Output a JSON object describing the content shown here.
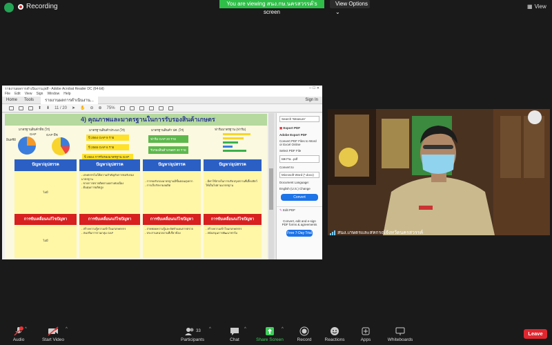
{
  "zoom": {
    "recording_label": "Recording",
    "share_banner": "You are viewing สนง.กษ.นครสวรรค์'s screen",
    "view_options_label": "View Options",
    "view_label": "View",
    "participant_name": "สนง.เกษตรและสหกรณ์จังหวัดนครสวรรค์",
    "participant_count": "33",
    "leave_label": "Leave",
    "controls": {
      "audio": "Audio",
      "start_video": "Start Video",
      "participants": "Participants",
      "chat": "Chat",
      "share_screen": "Share Screen",
      "record": "Record",
      "reactions": "Reactions",
      "apps": "Apps",
      "whiteboards": "Whiteboards"
    },
    "colors": {
      "banner": "#2fbe48",
      "leave": "#e0272f",
      "share_accent": "#3fce5c"
    }
  },
  "acrobat": {
    "window_title": "รายงานผลการดำเนินงาน.pdf - Adobe Acrobat Reader DC (64-bit)",
    "menu": [
      "File",
      "Edit",
      "View",
      "Sign",
      "Window",
      "Help"
    ],
    "tabs": [
      "Home",
      "Tools"
    ],
    "doc_tab": "รายงานผลการดำเนินงาน...",
    "sign_in": "Sign In",
    "page_indicator": "11 / 20",
    "zoom_value": "75%",
    "slide": {
      "title": "4) คุณภาพและมาตรฐานในการรับรองสินค้าเกษตร",
      "chart1_caption": "มาตรฐานสินค้าพืช (ไร่)",
      "chart1_legend": [
        "GAP",
        "อินทรีย์"
      ],
      "chart2_caption": "GAP พืช",
      "chart3_caption": "มาตรฐานสินค้าประมง (ไร่)",
      "yellow_boxes": [
        "ปี 2564 GAP 9 ราย",
        "ปี 2565 GAP 6 ราย",
        "ปี 2564 การรับรองมาตรฐาน GAP 70 ราย"
      ],
      "chart4_caption": "มาตรฐานสินค้า ปศ. (ไร่)",
      "green_boxes": [
        "ฟาร์ม GAP 20 ราย",
        "รับรองสินค้าเกษตร 30 ราย"
      ],
      "chart5_caption": "ฟาร์มมาตรฐาน (ฟาร์ม)",
      "columns": [
        {
          "header": "ปัญหา/อุปสรรค",
          "body": "ไม่มี",
          "sol_header": "การขับเคลื่อน/แก้ไขปัญหา",
          "sol_body": "ไม่มี"
        },
        {
          "header": "ปัญหา/อุปสรรค",
          "body": "- เกษตรกรไม่ให้ความสำคัญกับการขอรับรองมาตรฐาน\n- ขาดการตรวจติดตามอย่างต่อเนื่อง\n- ต้นทุนการผลิตสูง",
          "sol_header": "การขับเคลื่อน/แก้ไขปัญหา",
          "sol_body": "- สร้างความรู้ความเข้าใจแก่เกษตรกร\n- ส่งเสริมการรวมกลุ่ม GAP"
        },
        {
          "header": "ปัญหา/อุปสรรค",
          "body": "- การขอรับรองมาตรฐานมีขั้นตอนยุ่งยาก\n- การเก็บรักษาผลผลิต",
          "sol_header": "การขับเคลื่อน/แก้ไขปัญหา",
          "sol_body": "- ถ่ายทอดความรู้และจัดทำแผนการตรวจ\n- ประสานหน่วยงานที่เกี่ยวข้อง"
        },
        {
          "header": "ปัญหา/อุปสรรค",
          "body": "- มีค่าใช้จ่ายในการปรับปรุงสถานที่เลี้ยงสัตว์ให้เป็นไปตามมาตรฐาน",
          "sol_header": "การขับเคลื่อน/แก้ไขปัญหา",
          "sol_body": "- สร้างความเข้าใจแก่เกษตรกร\n- สนับสนุนการพัฒนาฟาร์ม"
        }
      ]
    },
    "panel": {
      "search_placeholder": "Search 'Measure'",
      "export_title": "Export PDF",
      "adobe_export": "Adobe Export PDF",
      "convert_desc": "Convert PDF Files to Word or Excel Online",
      "select_file": "Select PDF File",
      "file_value": "ผลงาน...pdf",
      "convert_to": "Convert to",
      "format_value": "Microsoft Word (*.docx)",
      "doc_lang": "Document Language:",
      "lang_value": "English (U.S.) Change",
      "convert_btn": "Convert",
      "edit_pdf": "Edit PDF",
      "promo": "Convert, edit and e-sign PDF forms & agreements",
      "trial_btn": "Free 7-Day Trial"
    }
  }
}
